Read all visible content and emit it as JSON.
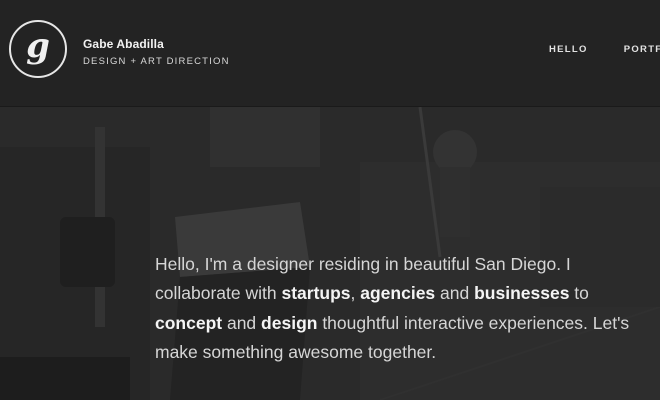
{
  "brand": {
    "logo_letter": "g",
    "name": "Gabe Abadilla",
    "tagline": "DESIGN + ART DIRECTION"
  },
  "nav": {
    "items": [
      "HELLO",
      "PORTFOLIO"
    ]
  },
  "intro": {
    "t1": "Hello, I'm a designer residing in beautiful San Diego. I collaborate with ",
    "startups": "startups",
    "t2": ", ",
    "agencies": "agencies",
    "t3": " and ",
    "businesses": "businesses",
    "t4": " to ",
    "concept": "concept",
    "t5": " and ",
    "design": "design",
    "t6": " thoughtful interactive experiences. Let's make something awesome together."
  },
  "colors": {
    "header_bg": "#232323",
    "hero_bg": "#2a2a2a",
    "text": "#d6d6d6",
    "emphasis": "#f4f4f4"
  }
}
